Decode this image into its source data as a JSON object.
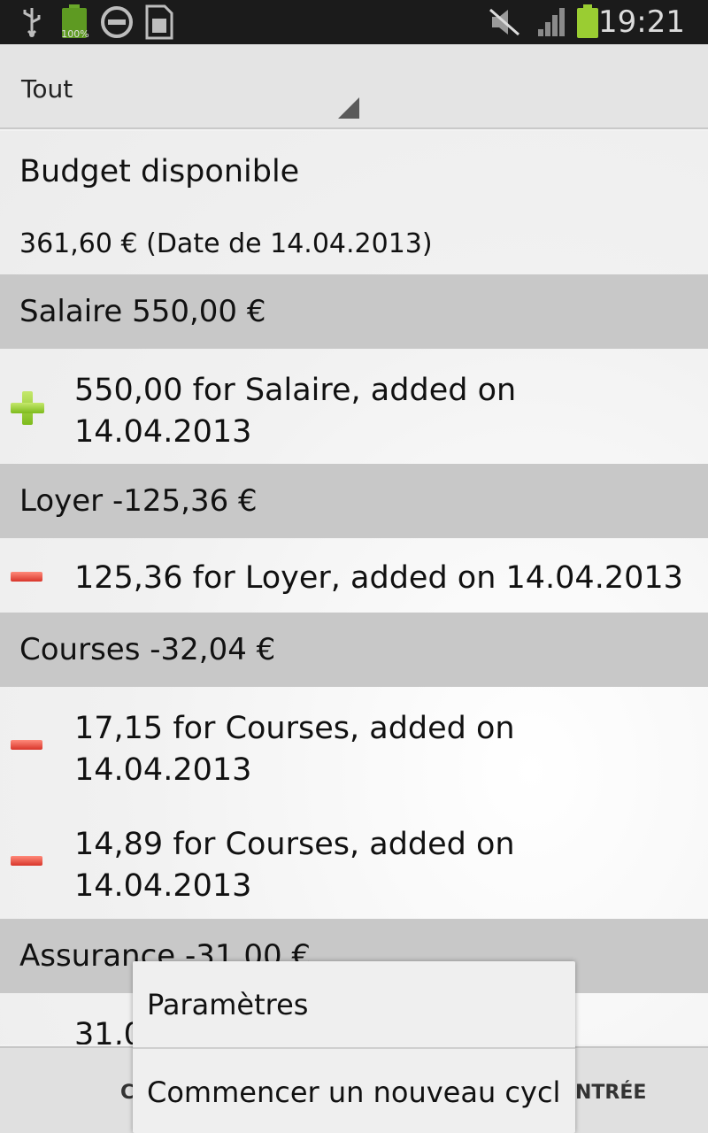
{
  "status_bar": {
    "battery_percent": "100%",
    "time": "19:21",
    "icons": [
      "usb-icon",
      "battery-icon",
      "do-not-disturb-icon",
      "sim-card-icon",
      "muted-speaker-icon",
      "signal-icon",
      "battery-icon"
    ]
  },
  "filter": {
    "selected": "Tout"
  },
  "budget": {
    "title": "Budget disponible",
    "value": "361,60 € (Date de 14.04.2013)"
  },
  "categories": [
    {
      "header": "Salaire 550,00 €",
      "entries": [
        {
          "type": "income",
          "text": "550,00 for Salaire, added on 14.04.2013"
        }
      ]
    },
    {
      "header": "Loyer -125,36 €",
      "entries": [
        {
          "type": "expense",
          "text": "125,36 for Loyer, added on 14.04.2013"
        }
      ]
    },
    {
      "header": "Courses -32,04 €",
      "entries": [
        {
          "type": "expense",
          "text": "17,15 for Courses, added on 14.04.2013"
        },
        {
          "type": "expense",
          "text": "14,89 for Courses, added on 14.04.2013"
        }
      ]
    },
    {
      "header": "Assurance -31,00 €",
      "entries": [
        {
          "type": "expense",
          "text": "31,0"
        }
      ]
    }
  ],
  "action_bar": {
    "left_label": "C",
    "right_label": "NTRÉE"
  },
  "overflow_menu": {
    "items": [
      "Paramètres",
      "Commencer un nouveau cycl"
    ]
  },
  "colors": {
    "status_bar_bg": "#1b1b1b",
    "header_bg": "#c8c8c8",
    "income_icon": "#8cc63f",
    "expense_icon": "#e0483a"
  }
}
